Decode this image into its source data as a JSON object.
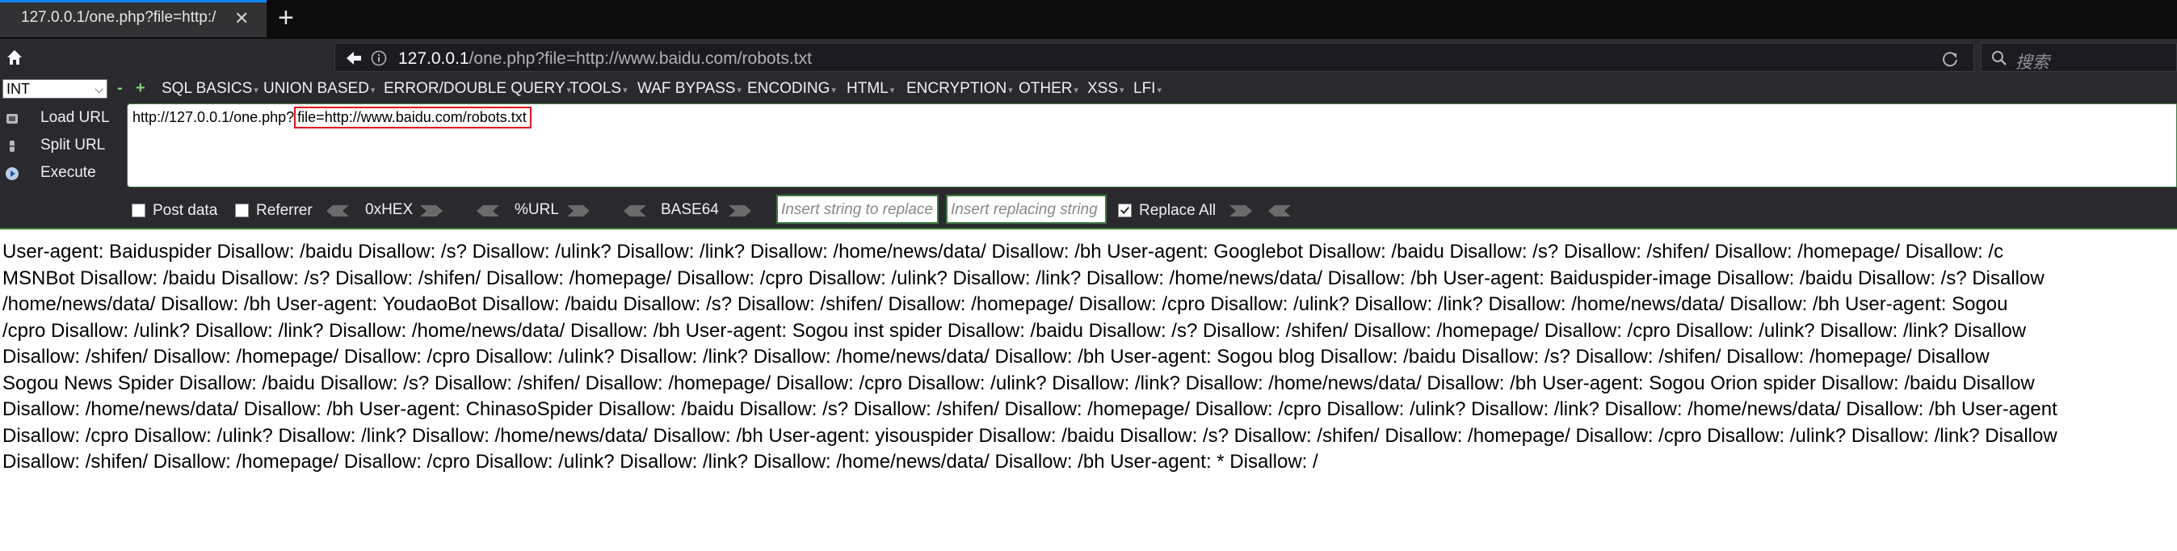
{
  "tab": {
    "title": "127.0.0.1/one.php?file=http:/",
    "close": "✕",
    "new_tab": "+"
  },
  "address_bar": {
    "url_host": "127.0.0.1",
    "url_path": "/one.php?file=http://www.baidu.com/robots.txt",
    "search_placeholder": "搜索"
  },
  "hackbar": {
    "select_value": "INT",
    "mini_minus": "-",
    "mini_plus": "+",
    "menu": [
      {
        "label": "SQL BASICS"
      },
      {
        "label": "UNION BASED"
      },
      {
        "label": "ERROR/DOUBLE QUERY"
      },
      {
        "label": "TOOLS"
      },
      {
        "label": "WAF BYPASS"
      },
      {
        "label": "ENCODING"
      },
      {
        "label": "HTML"
      },
      {
        "label": "ENCRYPTION"
      },
      {
        "label": "OTHER"
      },
      {
        "label": "XSS"
      },
      {
        "label": "LFI"
      }
    ],
    "load_url": "Load URL",
    "split_url": "Split URL",
    "execute": "Execute",
    "url_prefix": "http://127.0.0.1/one.php?",
    "url_param": "file=http://www.baidu.com/robots.txt",
    "post_data": "Post data",
    "referrer": "Referrer",
    "hex": "0xHEX",
    "url_enc": "%URL",
    "base64": "BASE64",
    "replace_placeholder": "Insert string to replace",
    "replacing_placeholder": "Insert replacing string",
    "replace_all": "Replace All"
  },
  "page": {
    "lines": [
      "User-agent: Baiduspider Disallow: /baidu Disallow: /s? Disallow: /ulink? Disallow: /link? Disallow: /home/news/data/ Disallow: /bh User-agent: Googlebot Disallow: /baidu Disallow: /s? Disallow: /shifen/ Disallow: /homepage/ Disallow: /c",
      "MSNBot Disallow: /baidu Disallow: /s? Disallow: /shifen/ Disallow: /homepage/ Disallow: /cpro Disallow: /ulink? Disallow: /link? Disallow: /home/news/data/ Disallow: /bh User-agent: Baiduspider-image Disallow: /baidu Disallow: /s? Disallow",
      "/home/news/data/ Disallow: /bh User-agent: YoudaoBot Disallow: /baidu Disallow: /s? Disallow: /shifen/ Disallow: /homepage/ Disallow: /cpro Disallow: /ulink? Disallow: /link? Disallow: /home/news/data/ Disallow: /bh User-agent: Sogou",
      "/cpro Disallow: /ulink? Disallow: /link? Disallow: /home/news/data/ Disallow: /bh User-agent: Sogou inst spider Disallow: /baidu Disallow: /s? Disallow: /shifen/ Disallow: /homepage/ Disallow: /cpro Disallow: /ulink? Disallow: /link? Disallow",
      "Disallow: /shifen/ Disallow: /homepage/ Disallow: /cpro Disallow: /ulink? Disallow: /link? Disallow: /home/news/data/ Disallow: /bh User-agent: Sogou blog Disallow: /baidu Disallow: /s? Disallow: /shifen/ Disallow: /homepage/ Disallow",
      "Sogou News Spider Disallow: /baidu Disallow: /s? Disallow: /shifen/ Disallow: /homepage/ Disallow: /cpro Disallow: /ulink? Disallow: /link? Disallow: /home/news/data/ Disallow: /bh User-agent: Sogou Orion spider Disallow: /baidu Disallow",
      "Disallow: /home/news/data/ Disallow: /bh User-agent: ChinasoSpider Disallow: /baidu Disallow: /s? Disallow: /shifen/ Disallow: /homepage/ Disallow: /cpro Disallow: /ulink? Disallow: /link? Disallow: /home/news/data/ Disallow: /bh User-agent",
      "Disallow: /cpro Disallow: /ulink? Disallow: /link? Disallow: /home/news/data/ Disallow: /bh User-agent: yisouspider Disallow: /baidu Disallow: /s? Disallow: /shifen/ Disallow: /homepage/ Disallow: /cpro Disallow: /ulink? Disallow: /link? Disallow",
      "Disallow: /shifen/ Disallow: /homepage/ Disallow: /cpro Disallow: /ulink? Disallow: /link? Disallow: /home/news/data/ Disallow: /bh User-agent: * Disallow: /"
    ]
  },
  "colors": {
    "tab_accent": "#0a84ff",
    "toolbar_bg": "#2a2a2e",
    "highlight_box": "#e0161d",
    "hackbar_green": "#3e7a3e"
  },
  "icons": [
    "home-icon",
    "back-icon",
    "info-icon",
    "reload-icon",
    "search-icon",
    "load-url-icon",
    "split-url-icon",
    "execute-icon",
    "checkbox-icon",
    "arrow-left-icon",
    "arrow-right-icon"
  ]
}
